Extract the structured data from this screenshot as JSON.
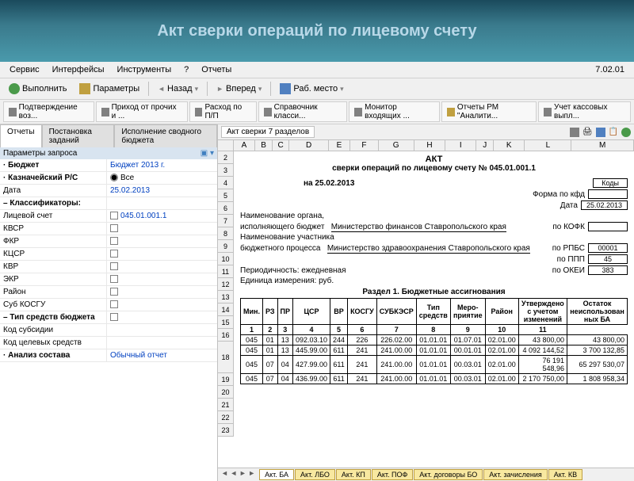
{
  "banner_title": "Акт сверки операций по лицевому счету",
  "menu": {
    "items": [
      "Сервис",
      "Интерфейсы",
      "Инструменты",
      "?",
      "Отчеты"
    ],
    "version": "7.02.01"
  },
  "toolbar": {
    "execute": "Выполнить",
    "params": "Параметры",
    "back": "Назад",
    "forward": "Вперед",
    "workplace": "Раб. место"
  },
  "tabs": [
    "Подтверждение воз...",
    "Приход от прочих и ...",
    "Расход по П/П",
    "Справочник класси...",
    "Монитор входящих ...",
    "Отчеты РМ \"Аналити...",
    "Учет кассовых выпл..."
  ],
  "left": {
    "tabs": [
      "Отчеты",
      "Постановка заданий",
      "Исполнение сводного бюджета"
    ],
    "params_header": "Параметры запроса",
    "rows": [
      {
        "label": "Бюджет",
        "value": "Бюджет 2013 г.",
        "bold": true,
        "link": true
      },
      {
        "label": "Казначейский Р/С",
        "value": "Все",
        "bold": true,
        "radio": true
      },
      {
        "label": "Дата",
        "value": "25.02.2013",
        "link": true
      },
      {
        "label": "Классификаторы:",
        "value": "",
        "bold": true
      },
      {
        "label": "Лицевой счет",
        "value": "045.01.001.1",
        "link": true,
        "check": true
      },
      {
        "label": "КВСР",
        "value": "",
        "check": true
      },
      {
        "label": "ФКР",
        "value": "",
        "check": true
      },
      {
        "label": "КЦСР",
        "value": "",
        "check": true
      },
      {
        "label": "КВР",
        "value": "",
        "check": true
      },
      {
        "label": "ЭКР",
        "value": "",
        "check": true
      },
      {
        "label": "Район",
        "value": "",
        "check": true
      },
      {
        "label": "Суб КОСГУ",
        "value": "",
        "check": true
      },
      {
        "label": "Тип средств бюджета",
        "value": "",
        "bold": true,
        "check": true
      },
      {
        "label": "Код субсидии",
        "value": ""
      },
      {
        "label": "Код целевых средств",
        "value": ""
      },
      {
        "label": "Анализ состава",
        "value": "Обычный отчет",
        "bold": true,
        "link": true
      }
    ]
  },
  "sheet": {
    "title": "Акт сверки 7 разделов",
    "cols": [
      "A",
      "B",
      "C",
      "D",
      "E",
      "F",
      "G",
      "H",
      "I",
      "J",
      "K",
      "L",
      "M"
    ],
    "rows": [
      "2",
      "3",
      "4",
      "5",
      "6",
      "7",
      "8",
      "9",
      "10",
      "11",
      "12",
      "13",
      "14",
      "15",
      "16",
      "18",
      "19",
      "20",
      "21",
      "22",
      "23"
    ],
    "doc": {
      "title": "АКТ",
      "subtitle": "сверки операций по лицевому счету № 045.01.001.1",
      "date_line": "на 25.02.2013",
      "kody_label": "Коды",
      "forma": "Форма по кфд",
      "date_label": "Дата",
      "date_value": "25.02.2013",
      "naim_organa": "Наименование органа,",
      "ispoln": "исполняющего бюджет",
      "ministry1": "Министерство финансов Ставропольского края",
      "kofk": "по КОФК",
      "naim_uch": "Наименование участника",
      "budg_proc": "бюджетного процесса",
      "ministry2": "Министерство здравоохранения Ставропольского края",
      "rpbs": "по РПБС",
      "rpbs_val": "00001",
      "ppp": "по ППП",
      "ppp_val": "45",
      "period": "Периодичность: ежедневная",
      "okei": "по ОКЕИ",
      "okei_val": "383",
      "ed_izm": "Единица измерения: руб.",
      "section1": "Раздел 1. Бюджетные ассигнования"
    },
    "table": {
      "headers": [
        "Мин.",
        "РЗ",
        "ПР",
        "ЦСР",
        "ВР",
        "КОСГУ",
        "СУБКЭСР",
        "Тип средств",
        "Меро-приятие",
        "Район",
        "Утверждено с учетом изменений",
        "Остаток неиспользован ных БА"
      ],
      "nums": [
        "1",
        "2",
        "3",
        "4",
        "5",
        "6",
        "7",
        "8",
        "9",
        "10",
        "11"
      ],
      "rows": [
        {
          "c": [
            "045",
            "01",
            "13",
            "092.03.10",
            "244",
            "226",
            "226.02.00",
            "01.01.01",
            "01.07.01",
            "02.01.00",
            "43 800,00",
            "43 800,00"
          ]
        },
        {
          "c": [
            "045",
            "01",
            "13",
            "445.99.00",
            "611",
            "241",
            "241.00.00",
            "01.01.01",
            "00.01.01",
            "02.01.00",
            "4 092 144,52",
            "3 700 132,85"
          ]
        },
        {
          "c": [
            "045",
            "07",
            "04",
            "427.99.00",
            "611",
            "241",
            "241.00.00",
            "01.01.01",
            "00.03.01",
            "02.01.00",
            "76 191 548,96",
            "65 297 530,07"
          ]
        },
        {
          "c": [
            "045",
            "07",
            "04",
            "436.99.00",
            "611",
            "241",
            "241.00.00",
            "01.01.01",
            "00.03.01",
            "02.01.00",
            "2 170 750,00",
            "1 808 958,34"
          ]
        }
      ]
    },
    "bottom_tabs": [
      "Акт. БА",
      "Акт. ЛБО",
      "Акт. КП",
      "Акт. ПОФ",
      "Акт. договоры БО",
      "Акт. зачисления",
      "Акт. КВ"
    ]
  },
  "chart_data": {
    "type": "table",
    "title": "Раздел 1. Бюджетные ассигнования",
    "columns": [
      "Мин.",
      "РЗ",
      "ПР",
      "ЦСР",
      "ВР",
      "КОСГУ",
      "СУБКЭСР",
      "Тип средств",
      "Мероприятие",
      "Район",
      "Утверждено с учетом изменений",
      "Остаток неиспользованных БА"
    ],
    "rows": [
      [
        "045",
        "01",
        "13",
        "092.03.10",
        "244",
        "226",
        "226.02.00",
        "01.01.01",
        "01.07.01",
        "02.01.00",
        43800.0,
        43800.0
      ],
      [
        "045",
        "01",
        "13",
        "445.99.00",
        "611",
        "241",
        "241.00.00",
        "01.01.01",
        "00.01.01",
        "02.01.00",
        4092144.52,
        3700132.85
      ],
      [
        "045",
        "07",
        "04",
        "427.99.00",
        "611",
        "241",
        "241.00.00",
        "01.01.01",
        "00.03.01",
        "02.01.00",
        76191548.96,
        65297530.07
      ],
      [
        "045",
        "07",
        "04",
        "436.99.00",
        "611",
        "241",
        "241.00.00",
        "01.01.01",
        "00.03.01",
        "02.01.00",
        2170750.0,
        1808958.34
      ]
    ]
  }
}
